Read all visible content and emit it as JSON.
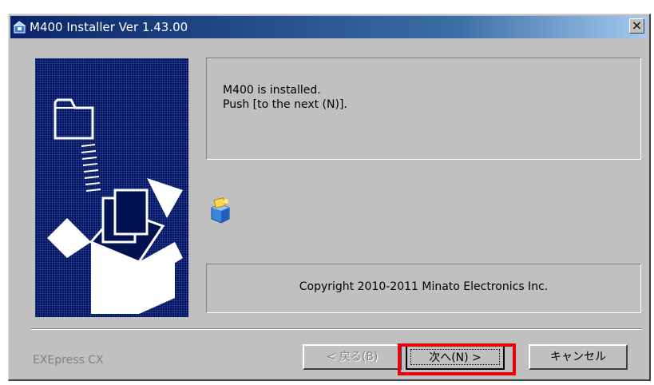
{
  "window": {
    "title": "M400 Installer Ver 1.43.00",
    "close_label": "×"
  },
  "message": {
    "line1": "M400 is installed.",
    "line2": "Push [to the next (N)]."
  },
  "copyright": "Copyright 2010-2011  Minato Electronics Inc.",
  "footer": {
    "brand": "EXEpress CX"
  },
  "buttons": {
    "back": "< 戻る(B)",
    "next": "次へ(N) >",
    "cancel": "キャンセル"
  },
  "colors": {
    "highlight": "#e8000b",
    "dialog_face": "#c0c0c0",
    "title_bar": "#0a246a",
    "graphic_background": "#00124f"
  },
  "icons": [
    "installer-icon",
    "close-icon",
    "install-box-graphic",
    "setup-icon"
  ]
}
